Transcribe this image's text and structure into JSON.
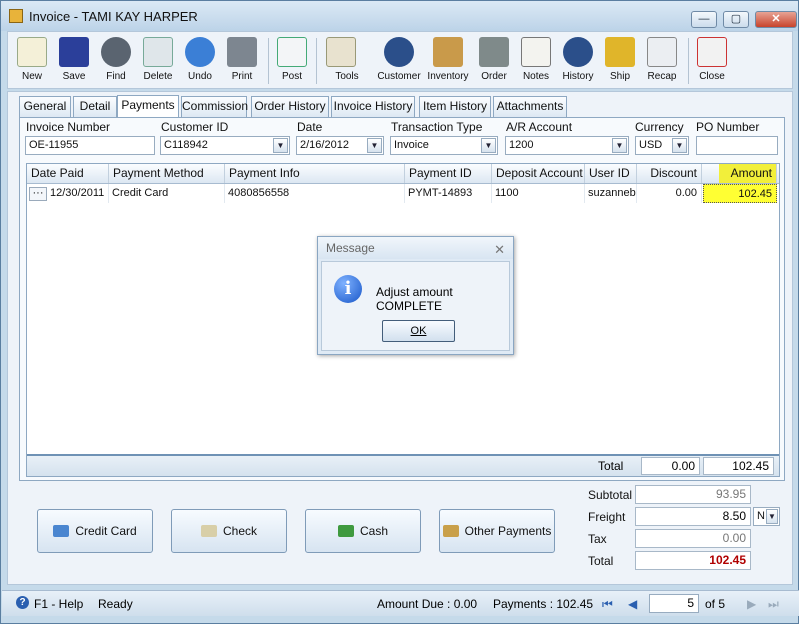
{
  "window": {
    "title": "Invoice - TAMI KAY HARPER",
    "minimize": "—",
    "maximize": "▢",
    "close": "✕"
  },
  "toolbar": {
    "items": [
      {
        "label": "New",
        "icon": "new-icon"
      },
      {
        "label": "Save",
        "icon": "save-icon"
      },
      {
        "label": "Find",
        "icon": "binoculars-icon"
      },
      {
        "label": "Delete",
        "icon": "recycle-bin-icon"
      },
      {
        "label": "Undo",
        "icon": "undo-icon"
      },
      {
        "label": "Print",
        "icon": "printer-icon"
      },
      {
        "label": "Post",
        "icon": "post-icon"
      },
      {
        "label": "Tools",
        "icon": "tools-icon"
      },
      {
        "label": "Customer",
        "icon": "customer-icon"
      },
      {
        "label": "Inventory",
        "icon": "inventory-icon"
      },
      {
        "label": "Order",
        "icon": "order-icon"
      },
      {
        "label": "Notes",
        "icon": "notes-icon"
      },
      {
        "label": "History",
        "icon": "history-icon"
      },
      {
        "label": "Ship",
        "icon": "ship-icon"
      },
      {
        "label": "Recap",
        "icon": "recap-icon"
      },
      {
        "label": "Close",
        "icon": "close-doc-icon"
      }
    ]
  },
  "tabs": [
    "General",
    "Detail",
    "Payments",
    "Commission",
    "Order History",
    "Invoice History",
    "Item History",
    "Attachments"
  ],
  "active_tab": "Payments",
  "header_fields": {
    "invoice_number": {
      "label": "Invoice Number",
      "value": "OE-11955"
    },
    "customer_id": {
      "label": "Customer ID",
      "value": "C118942"
    },
    "date": {
      "label": "Date",
      "value": "2/16/2012"
    },
    "transaction_type": {
      "label": "Transaction Type",
      "value": "Invoice"
    },
    "ar_account": {
      "label": "A/R Account",
      "value": "1200"
    },
    "currency": {
      "label": "Currency",
      "value": "USD"
    },
    "po_number": {
      "label": "PO Number",
      "value": ""
    }
  },
  "grid": {
    "columns": [
      "Date Paid",
      "Payment Method",
      "Payment Info",
      "Payment ID",
      "Deposit Account",
      "User ID",
      "Discount",
      "Amount"
    ],
    "rows": [
      {
        "ellipsis": "···",
        "date_paid": "12/30/2011",
        "method": "Credit Card",
        "info": "4080856558",
        "payment_id": "PYMT-14893",
        "deposit": "1100",
        "user": "suzanneb",
        "discount": "0.00",
        "amount": "102.45"
      }
    ],
    "footer": {
      "label": "Total",
      "discount": "0.00",
      "amount": "102.45"
    }
  },
  "payment_buttons": [
    "Credit Card",
    "Check",
    "Cash",
    "Other Payments"
  ],
  "totals": {
    "subtotal": {
      "label": "Subtotal",
      "value": "93.95"
    },
    "freight": {
      "label": "Freight",
      "value": "8.50",
      "code": "N"
    },
    "tax": {
      "label": "Tax",
      "value": "0.00"
    },
    "total": {
      "label": "Total",
      "value": "102.45"
    }
  },
  "status": {
    "help": "F1 - Help",
    "state": "Ready",
    "amount_due": "Amount Due : 0.00",
    "payments": "Payments : 102.45",
    "page": "5",
    "of": "of  5"
  },
  "dialog": {
    "title": "Message",
    "message": "Adjust amount COMPLETE",
    "ok": "OK",
    "close": "✕"
  },
  "colors": {
    "amount_highlight": "#ffff33",
    "total_red": "#b00000",
    "accent": "#2a5fb0"
  }
}
